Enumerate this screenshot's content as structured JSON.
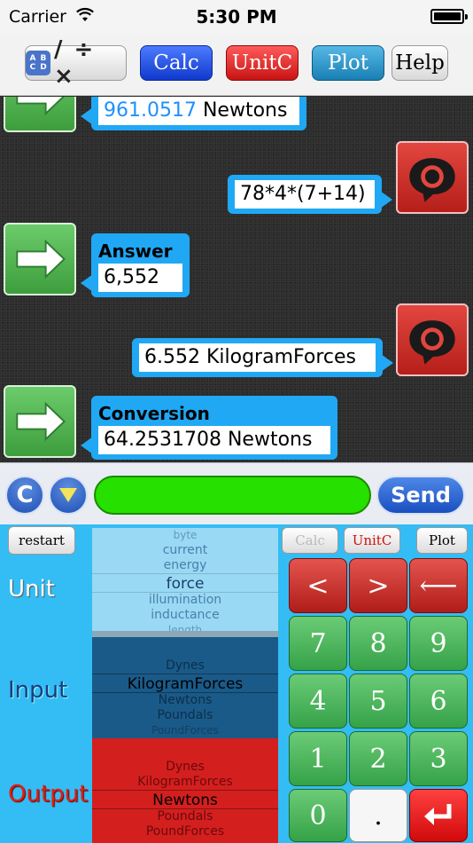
{
  "status": {
    "carrier": "Carrier",
    "time": "5:30 PM"
  },
  "toolbar": {
    "ops_abcd": [
      "A",
      "B",
      "C",
      "D"
    ],
    "ops_symbols": "/ ÷ ×",
    "calc": "Calc",
    "unitc": "UnitC",
    "plot": "Plot",
    "help": "Help"
  },
  "chat": {
    "msg1": {
      "value_number": "961.0517",
      "value_unit": " Newtons"
    },
    "msg2": {
      "text": "78*4*(7+14)"
    },
    "msg3": {
      "head": "Answer",
      "value": "6,552"
    },
    "msg4": {
      "text": "6.552 KilogramForces"
    },
    "msg5": {
      "head": "Conversion",
      "value": "64.2531708 Newtons"
    }
  },
  "inputbar": {
    "clear": "C",
    "input_value": "",
    "send": "Send"
  },
  "keyboard": {
    "restart": "restart",
    "labels": {
      "unit": "Unit",
      "input": "Input",
      "output": "Output"
    },
    "mode": {
      "calc": "Calc",
      "unitc": "UnitC",
      "plot": "Plot"
    },
    "unit_picker": {
      "above": [
        "byte",
        "current",
        "energy"
      ],
      "selected": "force",
      "below": [
        "illumination",
        "inductance",
        "length"
      ]
    },
    "input_picker": {
      "above": [
        "",
        "Dynes"
      ],
      "selected": "KilogramForces",
      "below": [
        "Newtons",
        "Poundals",
        "PoundForces"
      ]
    },
    "output_picker": {
      "above": [
        "Dynes",
        "KilogramForces"
      ],
      "selected": "Newtons",
      "below": [
        "Poundals",
        "PoundForces"
      ]
    },
    "keys": {
      "lt": "<",
      "gt": ">",
      "back": "⟵",
      "k7": "7",
      "k8": "8",
      "k9": "9",
      "k4": "4",
      "k5": "5",
      "k6": "6",
      "k1": "1",
      "k2": "2",
      "k3": "3",
      "k0": "0",
      "dot": "."
    }
  },
  "colors": {
    "bubble": "#20a8f4",
    "input_field": "#26e000",
    "keyboard_bg": "#33bdf4",
    "unit_picker": "#9ad9f3",
    "input_picker": "#1a5a88",
    "output_picker": "#d41f1f"
  },
  "icons": {
    "answer_avatar": "arrow-right-icon",
    "user_avatar": "speech-bubble-icon",
    "enter_key": "return-arrow-icon"
  }
}
